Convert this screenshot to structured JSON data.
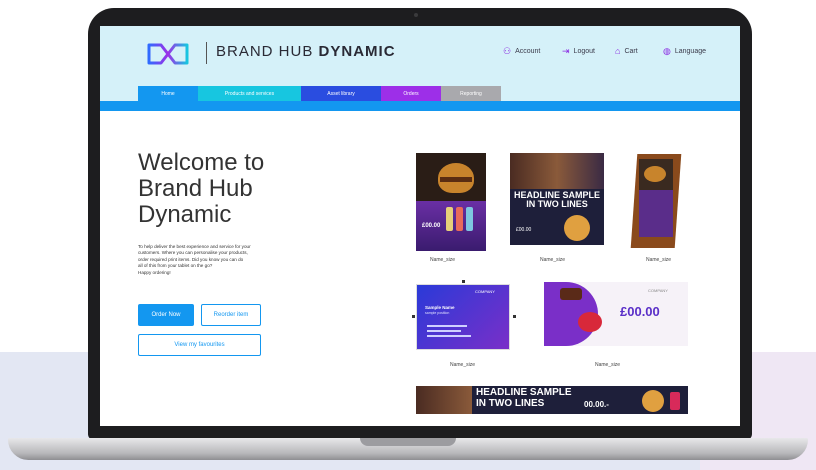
{
  "header": {
    "brand_light": "BRAND HUB",
    "brand_bold": "DYNAMIC",
    "nav": [
      {
        "label": "Account",
        "icon": "user-icon"
      },
      {
        "label": "Logout",
        "icon": "logout-icon"
      },
      {
        "label": "Cart",
        "icon": "cart-icon"
      },
      {
        "label": "Language",
        "icon": "globe-icon"
      }
    ]
  },
  "tabs": [
    {
      "label": "Home",
      "color": "#1397f0"
    },
    {
      "label": "Products and services",
      "color": "#17c6e0"
    },
    {
      "label": "Asset library",
      "color": "#2a4de0"
    },
    {
      "label": "Orders",
      "color": "#9d2fe8"
    },
    {
      "label": "Reporting",
      "color": "#a9a9ad"
    }
  ],
  "hero": {
    "title_lines": [
      "Welcome to",
      "Brand Hub",
      "Dynamic"
    ],
    "intro_lines": [
      "To help deliver the best experience and service for your",
      "customers. Where you can personalise your products,",
      "order required print items. Did you know you can do",
      "all of this from your tablet on the go?",
      "Happy ordering!"
    ],
    "order_now": "Order Now",
    "reorder_item": "Reorder item",
    "view_favourites": "View my favourites"
  },
  "gallery": {
    "captions": [
      "Name_size",
      "Name_size",
      "Name_size",
      "Name_size",
      "Name_size"
    ],
    "headline": "HEADLINE SAMPLE IN TWO LINES",
    "headline_line1": "HEADLINE SAMPLE",
    "headline_line2": "IN TWO LINES",
    "poster_price": "£00.00",
    "flyer_price": "£00.00",
    "leaflet_price": "£00.00",
    "banner_price": "00.00.-",
    "company": "COMPANY",
    "card_name": "Sample Name",
    "card_position": "sample position"
  },
  "colors": {
    "header_bg": "#d5f1f9",
    "accent_blue": "#1397f0",
    "brand_purple": "#8a2be2"
  }
}
